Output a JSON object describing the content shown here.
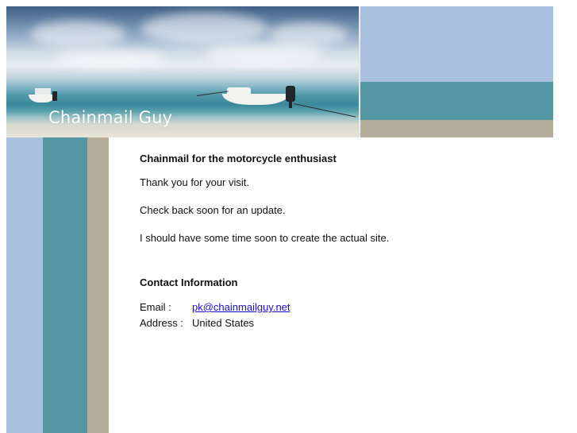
{
  "banner": {
    "site_title": "Chainmail Guy"
  },
  "colors": {
    "blue": "#a8c0dd",
    "teal": "#5598a4",
    "tan": "#b7ad9b",
    "link": "#1a0dcc"
  },
  "main": {
    "heading": "Chainmail for the motorcycle enthusiast",
    "paragraphs": [
      "Thank you for your visit.",
      "Check back soon for an update.",
      "I should have some time soon to create the actual site."
    ]
  },
  "contact": {
    "heading": "Contact Information",
    "email_label": "Email :",
    "email_value": "pk@chainmailguy.net",
    "address_label": "Address :",
    "address_value": "United States"
  }
}
